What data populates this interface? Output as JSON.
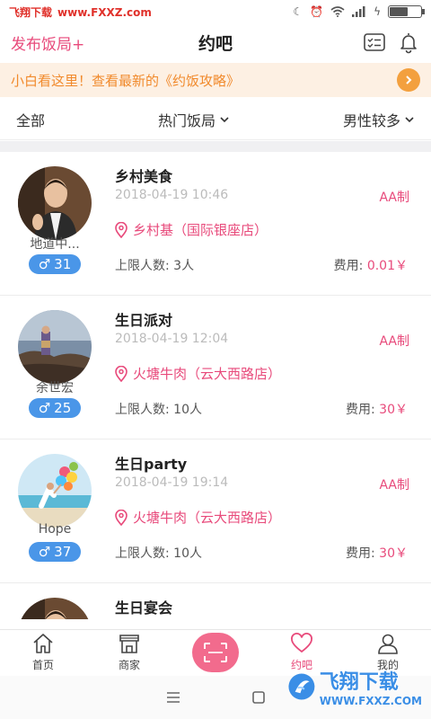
{
  "watermark_top": {
    "text1": "飞翔下载",
    "text2": "www.FXXZ.com"
  },
  "header": {
    "publish_label": "发布饭局+",
    "title": "约吧"
  },
  "notice": {
    "text": "小白看这里！查看最新的《约饭攻略》"
  },
  "filters": {
    "all": "全部",
    "hot": "热门饭局",
    "gender": "男性较多"
  },
  "events": [
    {
      "title": "乡村美食",
      "date": "2018-04-19 10:46",
      "pay_type": "AA制",
      "location": "乡村基（国际银座店）",
      "limit_label": "上限人数: 3人",
      "fee_label": "费用:",
      "fee_value": "0.01￥",
      "nickname": "地道中...",
      "age": "31",
      "avatar": "avatar-man-suit"
    },
    {
      "title": "生日派对",
      "date": "2018-04-19 12:04",
      "pay_type": "AA制",
      "location": "火塘牛肉（云大西路店）",
      "limit_label": "上限人数: 10人",
      "fee_label": "费用:",
      "fee_value": "30￥",
      "nickname": "余世宏",
      "age": "25",
      "avatar": "avatar-sea-rocks"
    },
    {
      "title": "生日party",
      "date": "2018-04-19 19:14",
      "pay_type": "AA制",
      "location": "火塘牛肉（云大西路店）",
      "limit_label": "上限人数: 10人",
      "fee_label": "费用:",
      "fee_value": "30￥",
      "nickname": "Hope",
      "age": "37",
      "avatar": "avatar-balloons"
    },
    {
      "title": "生日宴会",
      "date": "",
      "pay_type": "",
      "location": "",
      "limit_label": "",
      "fee_label": "",
      "fee_value": "",
      "nickname": "",
      "age": "",
      "avatar": "avatar-man-suit"
    }
  ],
  "tabs": [
    {
      "label": "首页",
      "icon": "home-icon"
    },
    {
      "label": "商家",
      "icon": "store-icon"
    },
    {
      "label": "",
      "icon": "scan-icon"
    },
    {
      "label": "约吧",
      "icon": "heart-icon"
    },
    {
      "label": "我的",
      "icon": "user-icon"
    }
  ],
  "watermark_bottom": {
    "big": "飞翔下载",
    "small": "WWW.FXXZ.COM"
  },
  "colors": {
    "accent": "#e84a7b",
    "notice_text": "#f18a2c",
    "badge": "#4a96e8"
  }
}
